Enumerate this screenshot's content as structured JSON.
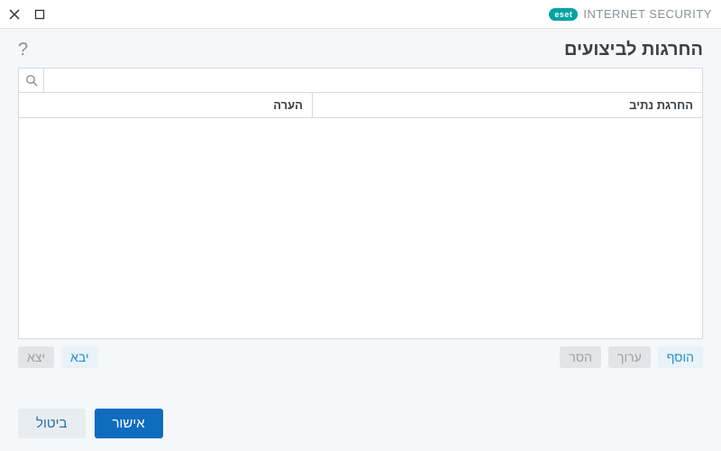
{
  "brand": {
    "logo_text": "eset",
    "product": "INTERNET SECURITY"
  },
  "header": {
    "title": "החרגות לביצועים"
  },
  "search": {
    "placeholder": ""
  },
  "table": {
    "columns": {
      "path": "החרגת נתיב",
      "note": "הערה"
    },
    "rows": []
  },
  "list_actions": {
    "add": "הוסף",
    "edit": "ערוך",
    "remove": "הסר",
    "import": "יבא",
    "export": "יצא"
  },
  "footer": {
    "ok": "אישור",
    "cancel": "ביטול"
  }
}
